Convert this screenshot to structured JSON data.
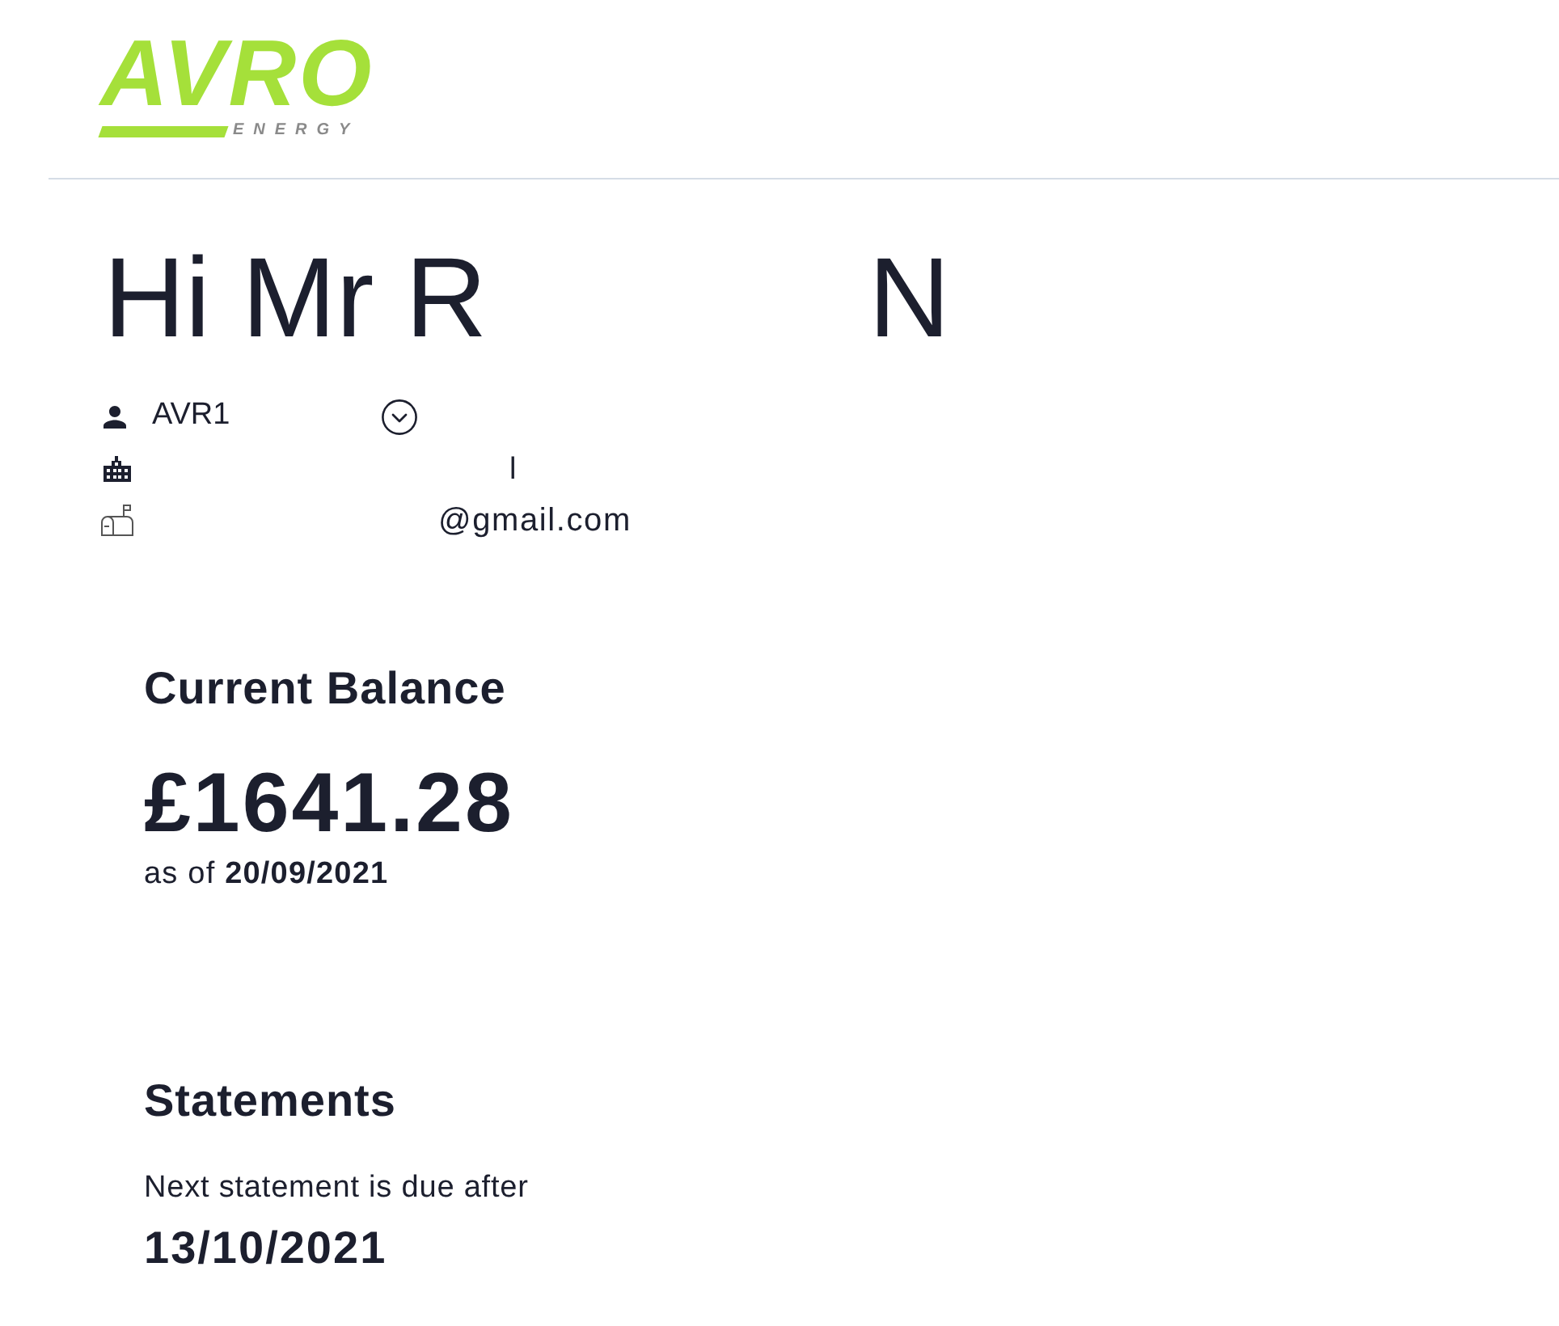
{
  "header": {
    "logo": {
      "wordmark": "AVRO",
      "tagline": "ENERGY"
    }
  },
  "greeting": {
    "parts": [
      "Hi Mr R",
      "N"
    ]
  },
  "account": {
    "number": "AVR1",
    "address": "l",
    "email": "@gmail.com"
  },
  "balance": {
    "title": "Current Balance",
    "amount": "£1641.28",
    "as_of": "as of **20/09/2021**"
  },
  "statements": {
    "title": "Statements",
    "note": "Next statement is due after",
    "due_date": "13/10/2021"
  }
}
